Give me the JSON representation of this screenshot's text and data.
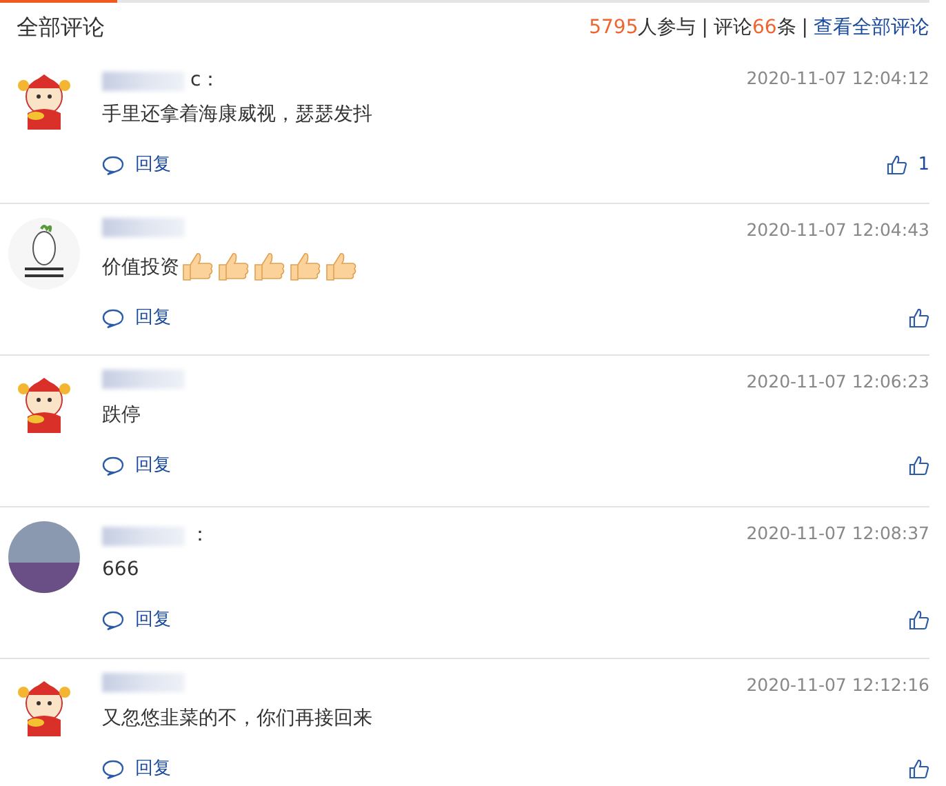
{
  "header": {
    "title": "全部评论",
    "participants": "5795",
    "participants_label": "人参与",
    "separators": [
      "|",
      "|"
    ],
    "comments_label": "评论",
    "comments": "66",
    "comments_unit": "条",
    "view_all": "查看全部评论"
  },
  "comments": [
    {
      "avatar": {
        "kind": "mascot"
      },
      "name_tail": "c：",
      "date": "2020-11-07 12:04:12",
      "text": "手里还拿着海康威视，瑟瑟发抖",
      "reply": "回复",
      "likes": "1"
    },
    {
      "avatar": {
        "kind": "radish"
      },
      "date": "2020-11-07 12:04:43",
      "text": "价值投资",
      "emojis": [
        {
          "kind": "thumbs-up"
        },
        {
          "kind": "thumbs-up"
        },
        {
          "kind": "thumbs-up"
        },
        {
          "kind": "thumbs-up"
        },
        {
          "kind": "thumbs-up"
        }
      ],
      "reply": "回复"
    },
    {
      "avatar": {
        "kind": "mascot"
      },
      "date": "2020-11-07 12:06:23",
      "text": "跌停",
      "reply": "回复"
    },
    {
      "avatar": {
        "kind": "photo"
      },
      "name_tail": "：",
      "date": "2020-11-07 12:08:37",
      "text": "666",
      "reply": "回复"
    },
    {
      "avatar": {
        "kind": "mascot"
      },
      "date": "2020-11-07 12:12:16",
      "text": "又忽悠韭菜的不，你们再接回来",
      "reply": "回复"
    }
  ]
}
